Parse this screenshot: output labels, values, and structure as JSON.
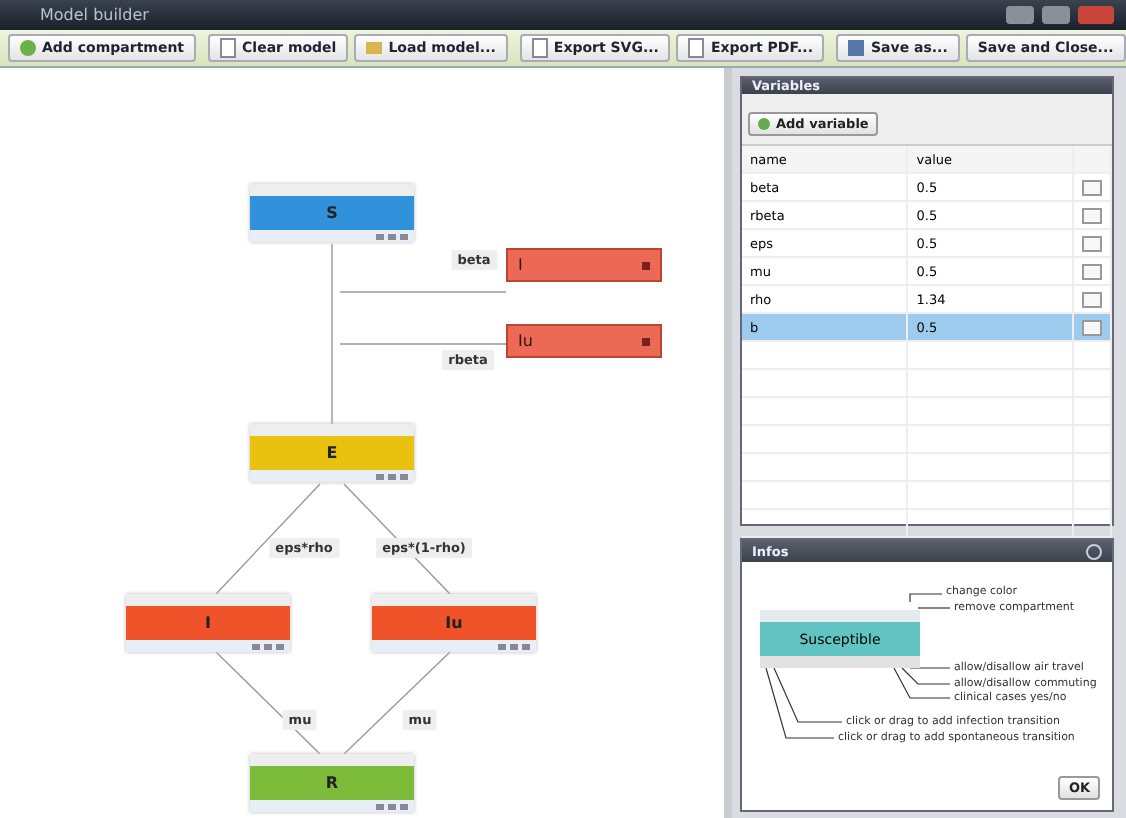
{
  "window": {
    "title": "Model builder"
  },
  "toolbar": [
    {
      "label": "Add compartment"
    },
    {
      "label": "Clear model"
    },
    {
      "label": "Load model..."
    },
    {
      "label": "Export SVG..."
    },
    {
      "label": "Export PDF..."
    },
    {
      "label": "Save as..."
    },
    {
      "label": "Save and Close..."
    }
  ],
  "canvas": {
    "compartments": [
      {
        "label": "S",
        "color": "#3192db"
      },
      {
        "label": "E",
        "color": "#e8c20e"
      },
      {
        "label": "I",
        "color": "#f0522a"
      },
      {
        "label": "Iu",
        "color": "#f0522a"
      },
      {
        "label": "R",
        "color": "#7cbc3a"
      }
    ],
    "sources": [
      {
        "label": "I",
        "color": "#ec6a55"
      },
      {
        "label": "Iu",
        "color": "#ec6a55"
      }
    ],
    "transition_labels": [
      "beta",
      "rbeta",
      "eps*rho",
      "eps*(1-rho)",
      "mu",
      "mu"
    ]
  },
  "variables": {
    "title": "Variables",
    "add_button": "Add variable",
    "columns": [
      "name",
      "value"
    ],
    "rows": [
      {
        "name": "beta",
        "value": "0.5",
        "selected": false
      },
      {
        "name": "rbeta",
        "value": "0.5",
        "selected": false
      },
      {
        "name": "eps",
        "value": "0.5",
        "selected": false
      },
      {
        "name": "mu",
        "value": "0.5",
        "selected": false
      },
      {
        "name": "rho",
        "value": "1.34",
        "selected": false
      },
      {
        "name": "b",
        "value": "0.5",
        "selected": true
      }
    ]
  },
  "info": {
    "title": "Infos",
    "sample": "Susceptible",
    "notes": [
      "change color",
      "remove compartment",
      "allow/disallow air travel",
      "allow/disallow commuting",
      "clinical cases yes/no",
      "click or drag to add infection transition",
      "click or drag to add spontaneous transition"
    ],
    "ok_button": "OK"
  }
}
